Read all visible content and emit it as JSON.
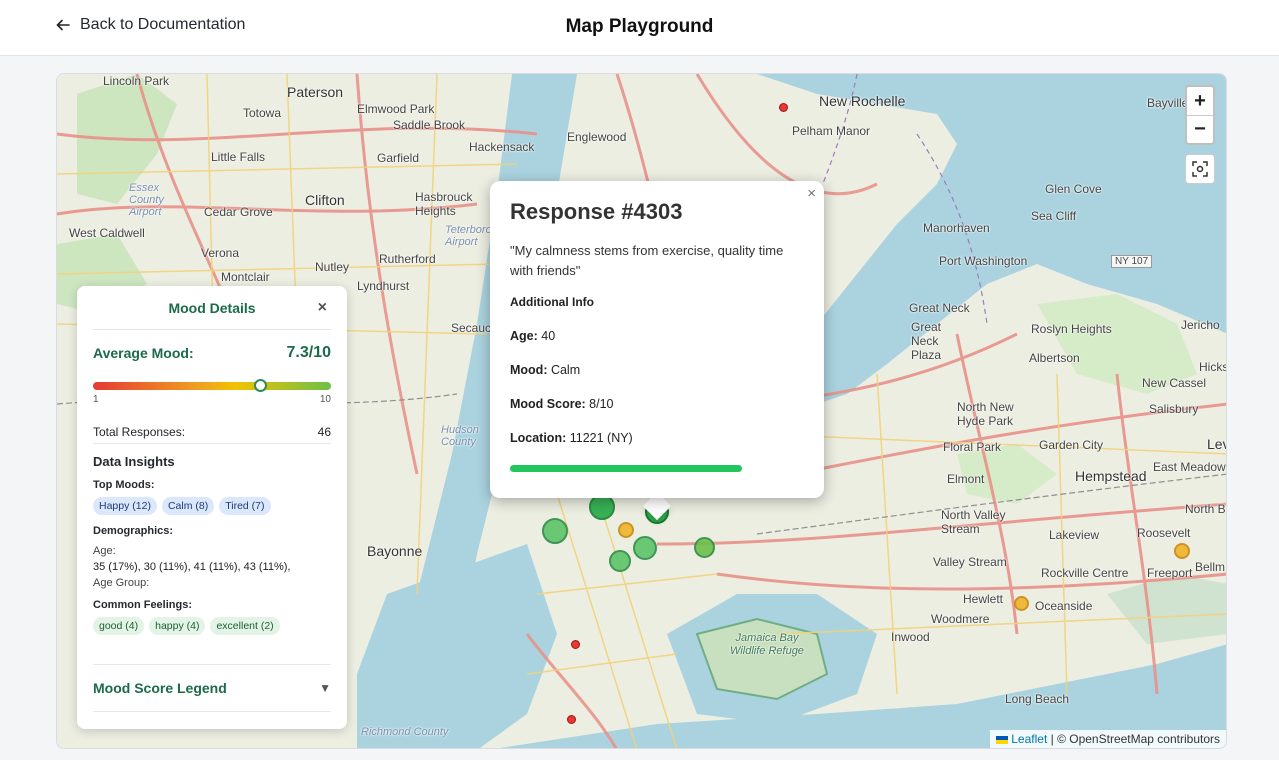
{
  "header": {
    "back_label": "Back to Documentation",
    "title": "Map Playground"
  },
  "map": {
    "zoom_in": "+",
    "zoom_out": "−",
    "attribution_leaflet": "Leaflet",
    "attribution_rest": "| © OpenStreetMap contributors",
    "places": [
      "Lincoln Park",
      "Paterson",
      "Elmwood Park",
      "Saddle Brook",
      "Totowa",
      "Little Falls",
      "Garfield",
      "Hackensack",
      "Englewood",
      "Clifton",
      "Hasbrouck Heights",
      "Teterboro Airport",
      "Cedar Grove",
      "Essex County Airport",
      "West Caldwell",
      "Verona",
      "Montclair",
      "Nutley",
      "Lyndhurst",
      "Rutherford",
      "Secaucus",
      "Hudson County",
      "Bayonne",
      "New Rochelle",
      "Pelham Manor",
      "Bayville",
      "Glen Cove",
      "Sea Cliff",
      "Manorhaven",
      "Port Washington",
      "Great Neck",
      "Great Neck Plaza",
      "Roslyn Heights",
      "Albertson",
      "Jericho",
      "New Cassel",
      "Hicks",
      "North New Hyde Park",
      "Salisbury",
      "Floral Park",
      "Garden City",
      "Lev",
      "Elmont",
      "Hempstead",
      "East Meadow",
      "North Valley Stream",
      "Lakeview",
      "Roosevelt",
      "North Bellm",
      "Valley Stream",
      "Rockville Centre",
      "Freeport",
      "Bellm",
      "Hewlett",
      "Oceanside",
      "Woodmere",
      "Inwood",
      "Long Beach",
      "Jamaica Bay Wildlife Refuge",
      "Richmond County",
      "NY 107"
    ],
    "markers": [
      {
        "mood": "green"
      },
      {
        "mood": "green"
      },
      {
        "mood": "green"
      },
      {
        "mood": "green"
      },
      {
        "mood": "green"
      },
      {
        "mood": "green"
      },
      {
        "mood": "yellow"
      },
      {
        "mood": "yellow"
      },
      {
        "mood": "yellow"
      },
      {
        "mood": "red"
      },
      {
        "mood": "red"
      },
      {
        "mood": "red"
      }
    ]
  },
  "mood_panel": {
    "title": "Mood Details",
    "close": "×",
    "average_label": "Average Mood:",
    "average_value": "7.3/10",
    "average_score": 7.3,
    "scale_min": "1",
    "scale_max": "10",
    "total_label": "Total Responses:",
    "total_value": "46",
    "insights_title": "Data Insights",
    "top_moods_title": "Top Moods:",
    "top_moods": [
      "Happy (12)",
      "Calm (8)",
      "Tired (7)"
    ],
    "demographics_title": "Demographics:",
    "age_label": "Age:",
    "age_values": "35 (17%), 30 (11%), 41 (11%), 43 (11%),",
    "age_group_label": "Age Group:",
    "feelings_title": "Common Feelings:",
    "feelings": [
      "good (4)",
      "happy (4)",
      "excellent (2)"
    ],
    "legend_label": "Mood Score Legend",
    "legend_caret": "▼"
  },
  "popup": {
    "title": "Response #4303",
    "close": "×",
    "quote": "\"My calmness stems from exercise, quality time with friends\"",
    "additional_info": "Additional Info",
    "age_label": "Age:",
    "age_value": " 40",
    "mood_label": "Mood:",
    "mood_value": " Calm",
    "score_label": "Mood Score:",
    "score_value": " 8/10",
    "location_label": "Location:",
    "location_value": " 11221 (NY)",
    "score_fraction": 0.8
  },
  "colors": {
    "accent": "#1b6b4a",
    "marker_green": "#2fae4e",
    "marker_yellow": "#f0b429",
    "marker_red": "#e53935",
    "score_bar": "#22c55e"
  }
}
